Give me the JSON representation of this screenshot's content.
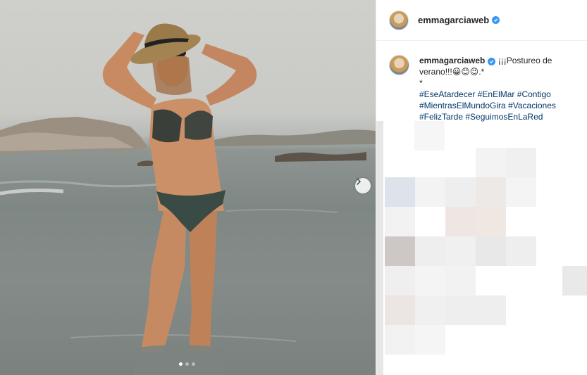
{
  "post": {
    "username": "emmagarciaweb",
    "verified": true,
    "caption_text": "¡¡¡Postureo de verano!!!",
    "caption_emojis": "😀😊😉",
    "caption_suffix": ".*",
    "caption_line2": "*",
    "hashtags": [
      "#EseAtardecer",
      "#EnElMar",
      "#Contigo",
      "#MientrasElMundoGira",
      "#Vacaciones",
      "#FelizTarde",
      "#SeguimosEnLaRed"
    ]
  },
  "carousel": {
    "total_slides": 3,
    "active_slide": 1,
    "next_icon": "chevron-right-icon"
  },
  "colors": {
    "link": "#00376b",
    "verified": "#3897f0",
    "text": "#262626",
    "divider": "#efefef"
  }
}
